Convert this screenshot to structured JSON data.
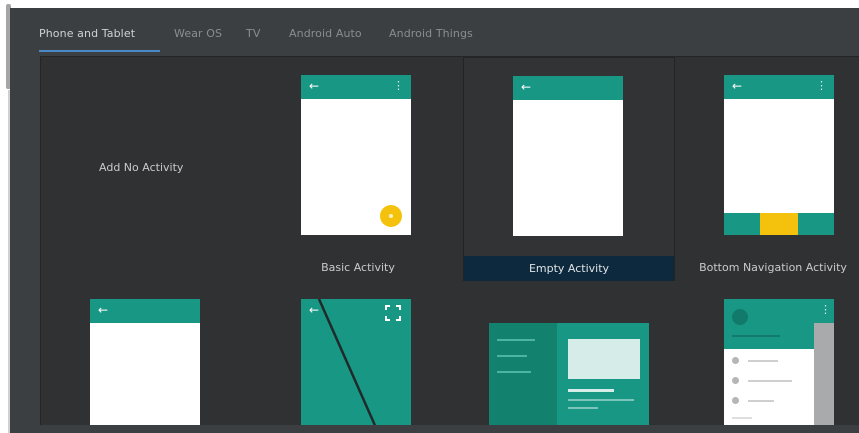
{
  "tabs": [
    {
      "label": "Phone and Tablet",
      "active": true
    },
    {
      "label": "Wear OS",
      "active": false
    },
    {
      "label": "TV",
      "active": false
    },
    {
      "label": "Android Auto",
      "active": false
    },
    {
      "label": "Android Things",
      "active": false
    }
  ],
  "templates": {
    "add_no_activity": "Add No Activity",
    "basic_activity": "Basic Activity",
    "empty_activity": "Empty Activity",
    "bottom_navigation_activity": "Bottom Navigation Activity"
  },
  "icons": {
    "back_arrow": "←",
    "overflow_menu": "⋮",
    "fullscreen": "⛶"
  },
  "selected_template": "Empty Activity",
  "colors": {
    "background": "#3c3f41",
    "gallery": "#2f3133",
    "selection_label": "#0d293e",
    "teal": "#199785",
    "accent_yellow": "#f4c20d",
    "tab_underline": "#4a88c7"
  }
}
